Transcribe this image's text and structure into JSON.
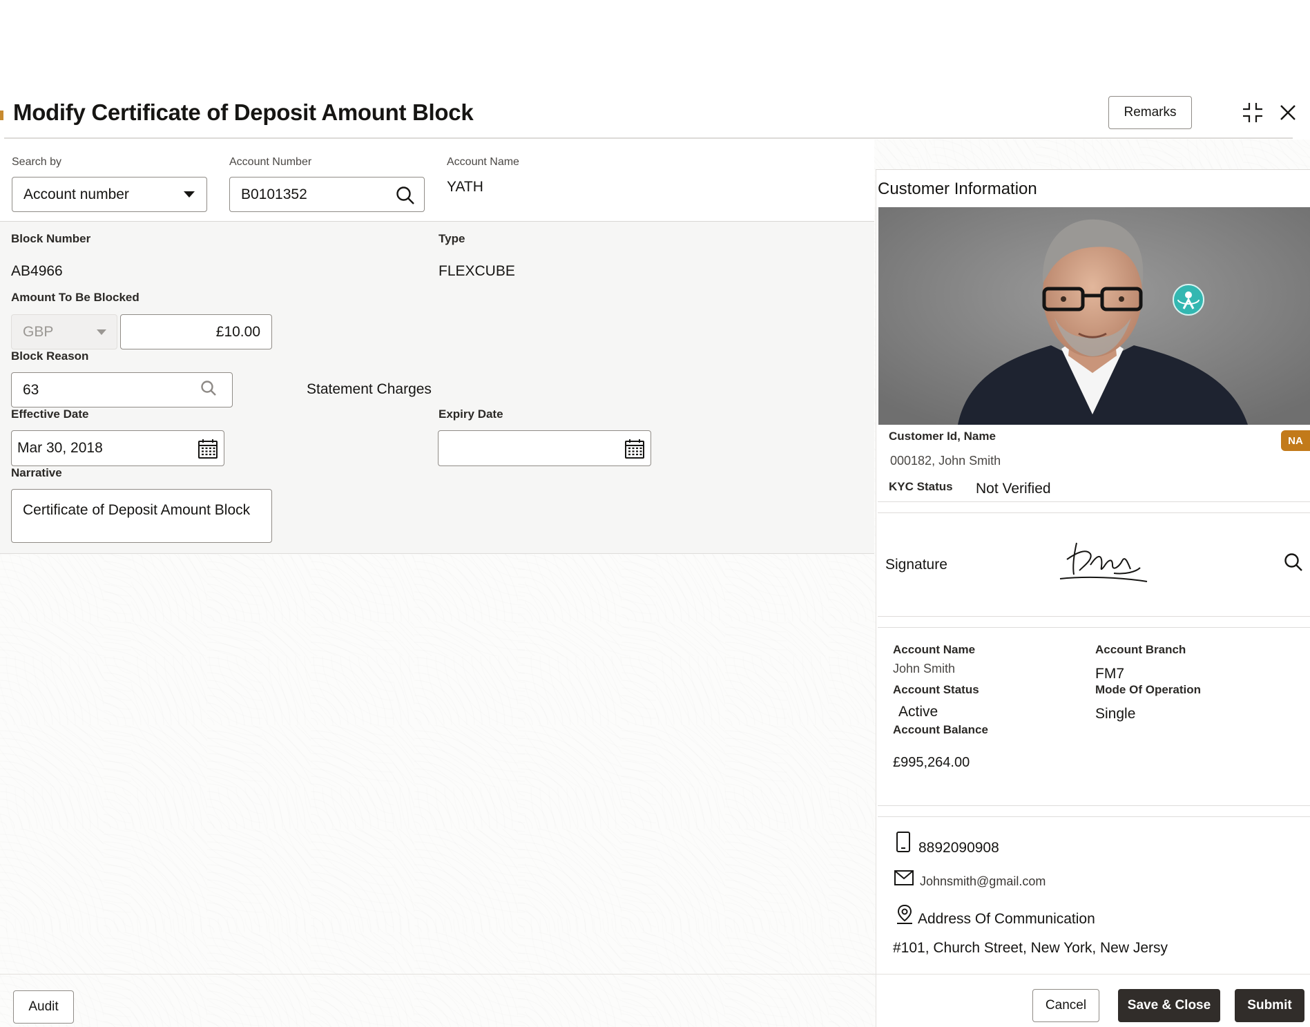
{
  "title": "Modify Certificate of Deposit Amount Block",
  "toolbar": {
    "remarks_label": "Remarks"
  },
  "search": {
    "search_by_label": "Search by",
    "search_by_value": "Account number",
    "account_number_label": "Account Number",
    "account_number_value": "B0101352",
    "account_name_label": "Account Name",
    "account_name_value": "YATH"
  },
  "block": {
    "block_number_label": "Block Number",
    "block_number_value": "AB4966",
    "type_label": "Type",
    "type_value": "FLEXCUBE",
    "amount_label": "Amount To Be Blocked",
    "currency": "GBP",
    "amount": "£10.00",
    "reason_label": "Block Reason",
    "reason_value": "63",
    "reason_description": "Statement Charges",
    "effective_date_label": "Effective Date",
    "effective_date_value": "Mar 30, 2018",
    "expiry_date_label": "Expiry Date",
    "expiry_date_value": "",
    "narrative_label": "Narrative",
    "narrative_value": "Certificate of Deposit Amount Block"
  },
  "customer": {
    "heading": "Customer Information",
    "id_name_label": "Customer Id, Name",
    "id_name_value": "000182, John Smith",
    "badge": "NA",
    "kyc_label": "KYC Status",
    "kyc_value": "Not Verified",
    "signature_label": "Signature",
    "account_name_label": "Account Name",
    "account_name_value": "John Smith",
    "account_branch_label": "Account Branch",
    "account_branch_value": "FM7",
    "account_status_label": "Account Status",
    "account_status_value": "Active",
    "mode_label": "Mode Of Operation",
    "mode_value": "Single",
    "balance_label": "Account Balance",
    "balance_value": "£995,264.00",
    "phone": "8892090908",
    "email": "Johnsmith@gmail.com",
    "address_label": "Address Of Communication",
    "address_value": "#101, Church Street, New York, New Jersy"
  },
  "footer": {
    "audit_label": "Audit",
    "cancel_label": "Cancel",
    "save_close_label": "Save & Close",
    "submit_label": "Submit"
  },
  "colors": {
    "primary_dark": "#312d2a",
    "badge": "#c27a1a",
    "accent_teal": "#33b7b1"
  },
  "icons": [
    "minimize-icon",
    "close-icon",
    "dropdown-caret-icon",
    "search-icon",
    "calendar-icon",
    "magnify-icon",
    "phone-icon",
    "mail-icon",
    "location-icon",
    "video-call-icon"
  ]
}
